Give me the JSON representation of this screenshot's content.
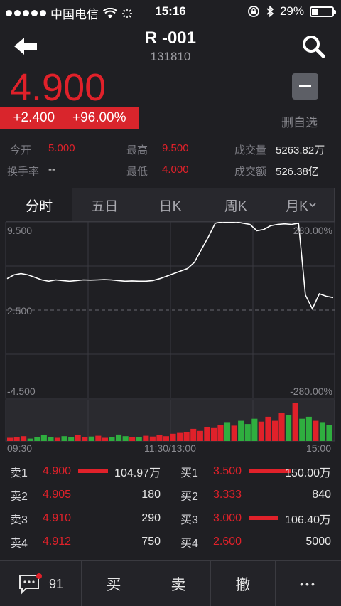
{
  "status": {
    "carrier": "中国电信",
    "time": "15:16",
    "battery": "29%",
    "battery_level": 0.29
  },
  "header": {
    "title": "R -001",
    "code": "131810"
  },
  "quote": {
    "price": "4.900",
    "change": "+2.400",
    "change_pct": "+96.00%",
    "delete_label": "删自选"
  },
  "stats": {
    "open_label": "今开",
    "open": "5.000",
    "high_label": "最高",
    "high": "9.500",
    "volume_label": "成交量",
    "volume": "5263.82万",
    "turnover_label": "换手率",
    "turnover": "--",
    "low_label": "最低",
    "low": "4.000",
    "amount_label": "成交额",
    "amount": "526.38亿"
  },
  "tabs": [
    "分时",
    "五日",
    "日K",
    "周K",
    "月K"
  ],
  "chart": {
    "y_top": "9.500",
    "y_mid": "2.500",
    "y_bottom": "-4.500",
    "pct_top": "280.00%",
    "pct_bottom": "-280.00%",
    "t_start": "09:30",
    "t_mid": "11:30/13:00",
    "t_end": "15:00"
  },
  "chart_data": {
    "type": "line",
    "ylim": [
      -4.5,
      9.5
    ],
    "baseline": 2.5,
    "x_ticks": [
      "09:30",
      "11:30/13:00",
      "15:00"
    ],
    "price": [
      5.0,
      5.3,
      5.4,
      5.3,
      5.1,
      4.9,
      4.8,
      4.9,
      4.85,
      4.8,
      4.85,
      4.9,
      4.88,
      4.9,
      4.92,
      4.9,
      4.85,
      4.8,
      4.82,
      4.8,
      4.8,
      4.85,
      5.0,
      5.2,
      5.4,
      5.6,
      5.8,
      6.3,
      7.3,
      8.3,
      9.4,
      9.5,
      9.45,
      9.5,
      9.4,
      9.3,
      8.8,
      8.9,
      9.2,
      9.3,
      9.35,
      9.3,
      9.4,
      3.7,
      2.6,
      3.8,
      3.6,
      3.5
    ],
    "volume": [
      0.08,
      0.1,
      0.12,
      0.06,
      0.09,
      0.15,
      0.1,
      0.08,
      0.12,
      0.1,
      0.14,
      0.09,
      0.11,
      0.13,
      0.08,
      0.1,
      0.16,
      0.12,
      0.1,
      0.09,
      0.13,
      0.11,
      0.15,
      0.12,
      0.18,
      0.2,
      0.22,
      0.3,
      0.25,
      0.35,
      0.32,
      0.4,
      0.45,
      0.38,
      0.5,
      0.42,
      0.55,
      0.48,
      0.6,
      0.5,
      0.7,
      0.65,
      0.95,
      0.55,
      0.6,
      0.5,
      0.45,
      0.4
    ]
  },
  "book": {
    "sells": [
      {
        "label": "卖1",
        "price": "4.900",
        "vol": "104.97万",
        "bar": 0.6
      },
      {
        "label": "卖2",
        "price": "4.905",
        "vol": "180",
        "bar": 0
      },
      {
        "label": "卖3",
        "price": "4.910",
        "vol": "290",
        "bar": 0
      },
      {
        "label": "卖4",
        "price": "4.912",
        "vol": "750",
        "bar": 0
      }
    ],
    "buys": [
      {
        "label": "买1",
        "price": "3.500",
        "vol": "150.00万",
        "bar": 0.85
      },
      {
        "label": "买2",
        "price": "3.333",
        "vol": "840",
        "bar": 0
      },
      {
        "label": "买3",
        "price": "3.000",
        "vol": "106.40万",
        "bar": 0.6
      },
      {
        "label": "买4",
        "price": "2.600",
        "vol": "5000",
        "bar": 0
      }
    ]
  },
  "bottom": {
    "comments": "91",
    "buy": "买",
    "sell": "卖",
    "cancel": "撤",
    "more": "•••"
  },
  "colors": {
    "red": "#e0212a",
    "green": "#2fae3f",
    "bg": "#1f1f23"
  }
}
